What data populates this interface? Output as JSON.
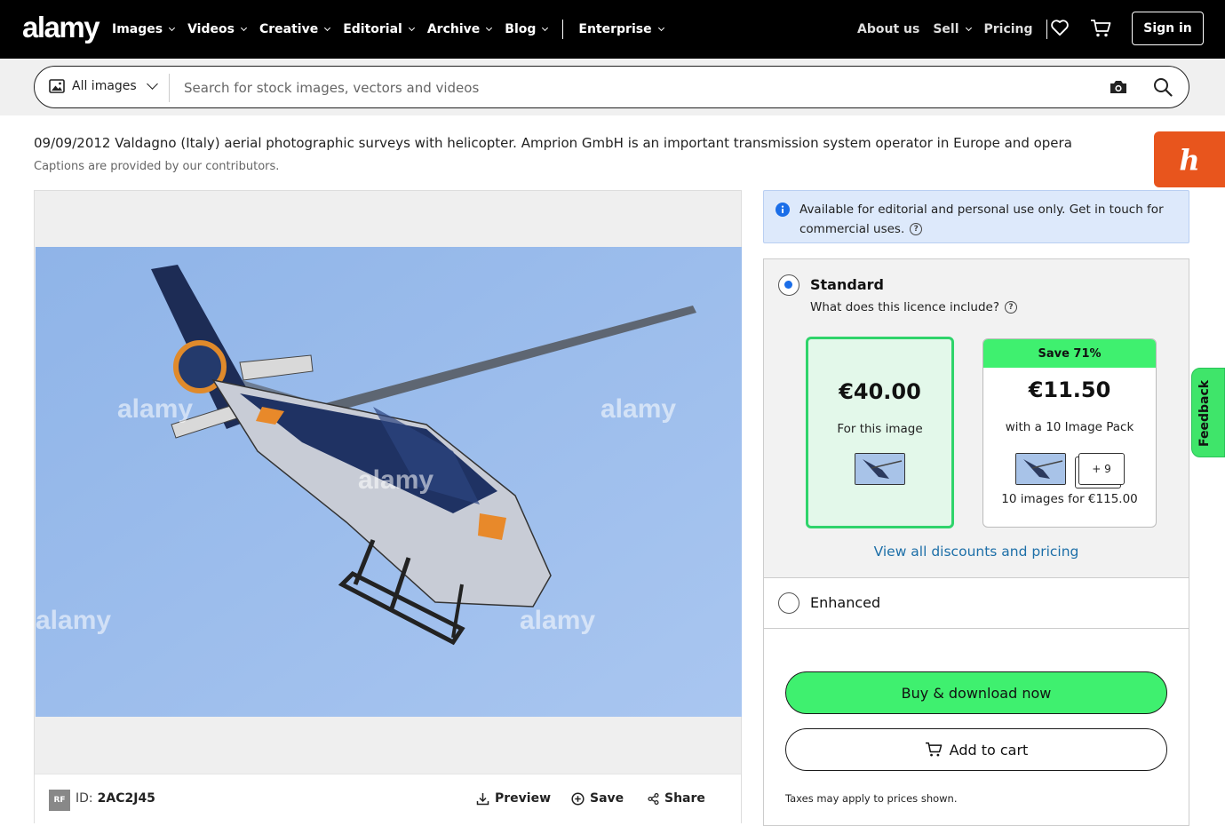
{
  "brand": {
    "logo": "alamy"
  },
  "nav": {
    "left_items": [
      "Images",
      "Videos",
      "Creative",
      "Editorial",
      "Archive",
      "Blog"
    ],
    "enterprise": "Enterprise",
    "right_items": {
      "about": "About us",
      "sell": "Sell",
      "pricing": "Pricing"
    },
    "signin": "Sign in",
    "icons": {
      "wishlist": "heart-icon",
      "cart": "cart-icon"
    }
  },
  "search": {
    "scope": "All images",
    "placeholder": "Search for stock images, vectors and videos",
    "value": "",
    "icons": {
      "visual_search": "camera-icon",
      "submit": "search-icon"
    }
  },
  "caption": {
    "title": "09/09/2012 Valdagno (Italy) aerial photographic surveys with helicopter. Amprion GmbH is an important transmission system operator in Europe and opera",
    "note": "Captions are provided by our contributors."
  },
  "image": {
    "badge": "RF",
    "id_label": "ID:",
    "id_value": "2AC2J45",
    "watermark": "alamy",
    "actions": {
      "preview": "Preview",
      "save": "Save",
      "share": "Share"
    }
  },
  "notice": {
    "text": "Available for editorial and personal use only. Get in touch for commercial uses."
  },
  "licence": {
    "standard_title": "Standard",
    "standard_sub": "What does this licence include?",
    "single": {
      "price": "€40.00",
      "note": "For this image"
    },
    "pack": {
      "badge": "Save 71%",
      "price": "€11.50",
      "note": "with a 10 Image Pack",
      "extra": "+ 9",
      "total": "10 images for €115.00"
    },
    "view_all": "View all discounts and pricing",
    "enhanced_title": "Enhanced",
    "selected": "Standard"
  },
  "purchase": {
    "buy": "Buy & download now",
    "cart": "Add to cart",
    "taxes": "Taxes may apply to prices shown."
  },
  "side_tabs": {
    "honey": "h",
    "feedback": "Feedback"
  },
  "colors": {
    "nav_bg": "#000000",
    "accent_green": "#3ff06f",
    "link_blue": "#1d6fa8",
    "notice_bg": "#dde9fb",
    "honey_orange": "#e8551d"
  }
}
